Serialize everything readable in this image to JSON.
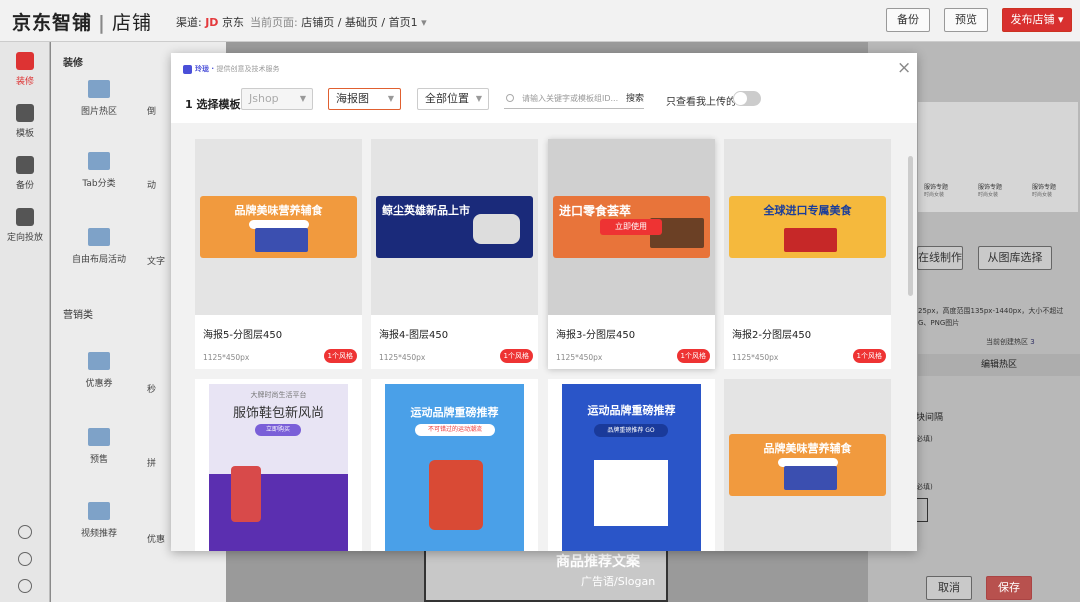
{
  "topbar": {
    "logo": "京东智铺",
    "sep": "|",
    "shop": "店铺",
    "channel_label": "渠道:",
    "channel_jd": "JD",
    "channel_name": "京东",
    "current_label": "当前页面:",
    "current_path": "店铺页 / 基础页 / 首页1",
    "backup": "备份",
    "preview": "预览",
    "publish": "发布店铺"
  },
  "nav": [
    {
      "label": "装修"
    },
    {
      "label": "模板"
    },
    {
      "label": "备份"
    },
    {
      "label": "定向投放"
    }
  ],
  "panel": {
    "section1": "装修",
    "section2": "营销类",
    "items": [
      "图片热区",
      "Tab分类",
      "自由布局活动",
      "优惠券",
      "预售",
      "视频推荐"
    ],
    "partial": [
      "倒",
      "动",
      "文字",
      "秒",
      "拼",
      "优惠"
    ]
  },
  "right": {
    "online": "在线制作",
    "gallery": "从图库选择",
    "desc1": "25px，高度范围135px-1440px，大小不超过",
    "desc2": "G、PNG图片",
    "hotzone_link": "当前创建热区",
    "hotzone_count": "3",
    "edit_hotzone": "编辑热区",
    "block_gap": "块间隔",
    "req1": "必填)",
    "req2": "必填)",
    "cancel": "取消",
    "save": "保存",
    "img_labels": [
      "服饰专题",
      "服饰专题",
      "服饰专题"
    ],
    "img_sub": [
      "时尚女装",
      "时尚女装",
      "时尚女装"
    ]
  },
  "canvas": {
    "text1": "商品推荐文案",
    "text2": "广告语/Slogan"
  },
  "modal": {
    "brand": "玲珑",
    "brand_sub": "提供创意及技术服务",
    "step": "1 选择模板",
    "platform": "Jshop",
    "type": "海报图",
    "position": "全部位置",
    "search_placeholder": "请输入关键字或模板组ID...",
    "search_btn": "搜索",
    "only_mine": "只查看我上传的",
    "close": "×"
  },
  "cards": [
    {
      "title": "海报5-分图层450",
      "size": "1125*450px",
      "badge": "1个风格",
      "banner_text": "品牌美味营养辅食"
    },
    {
      "title": "海报4-图层450",
      "size": "1125*450px",
      "badge": "1个风格",
      "banner_text": "鲸尘英雄新品上市"
    },
    {
      "title": "海报3-分图层450",
      "size": "1125*450px",
      "badge": "1个风格",
      "banner_text": "进口零食荟萃",
      "use_btn": "立即使用"
    },
    {
      "title": "海报2-分图层450",
      "size": "1125*450px",
      "badge": "1个风格",
      "banner_text": "全球进口专属美食"
    }
  ],
  "tall_cards": [
    {
      "top": "大牌时尚生活平台",
      "main": "服饰鞋包新风尚",
      "btn": "立即购买"
    },
    {
      "main": "运动品牌重磅推荐",
      "btn": "不可错过的运动潮流"
    },
    {
      "main": "运动品牌重磅推荐",
      "btn": "品牌重磅推荐 GO"
    },
    {
      "main": "品牌美味营养辅食"
    }
  ],
  "colors": {
    "accent": "#d8302f",
    "brand": "#4a4fd8"
  }
}
